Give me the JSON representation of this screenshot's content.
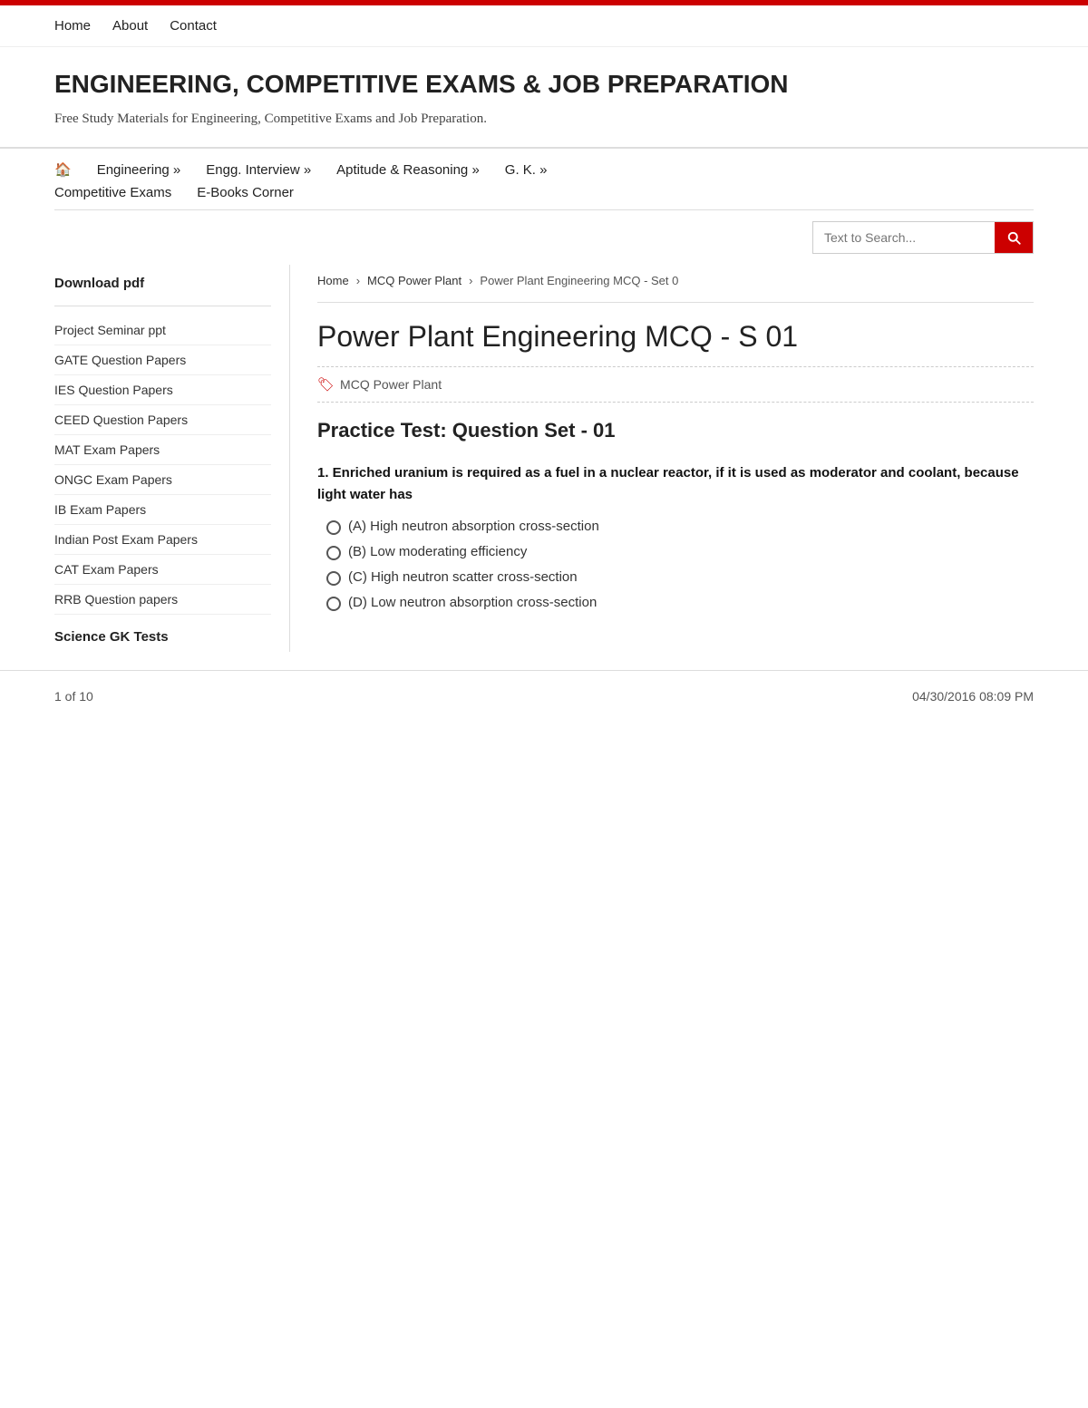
{
  "top_red_bar": {},
  "top_nav": {
    "items": [
      {
        "label": "Home",
        "id": "home"
      },
      {
        "label": "About",
        "id": "about"
      },
      {
        "label": "Contact",
        "id": "contact"
      }
    ]
  },
  "site_header": {
    "title": "ENGINEERING, COMPETITIVE EXAMS & JOB PREPARATION",
    "description": "Free Study Materials for Engineering, Competitive Exams and Job Preparation."
  },
  "main_nav": {
    "row1": [
      {
        "label": "🏠",
        "id": "home-icon",
        "is_icon": true
      },
      {
        "label": "Engineering »",
        "id": "engineering"
      },
      {
        "label": "Engg. Interview »",
        "id": "engg-interview"
      },
      {
        "label": "Aptitude & Reasoning »",
        "id": "aptitude"
      },
      {
        "label": "G. K. »",
        "id": "gk"
      }
    ],
    "row2": [
      {
        "label": "Competitive Exams",
        "id": "competitive-exams"
      },
      {
        "label": "E-Books Corner",
        "id": "ebooks"
      }
    ]
  },
  "search": {
    "placeholder": "Text to Search...",
    "button_label": "Search"
  },
  "sidebar": {
    "download_label": "Download pdf",
    "items": [
      {
        "label": "Project Seminar ppt"
      },
      {
        "label": "GATE Question Papers"
      },
      {
        "label": "IES Question Papers"
      },
      {
        "label": "CEED Question Papers"
      },
      {
        "label": "MAT Exam Papers"
      },
      {
        "label": "ONGC Exam Papers"
      },
      {
        "label": "IB Exam Papers"
      },
      {
        "label": "Indian Post Exam Papers"
      },
      {
        "label": "CAT Exam Papers"
      },
      {
        "label": "RRB Question papers"
      }
    ],
    "section_title": "Science GK Tests"
  },
  "breadcrumb": {
    "items": [
      {
        "label": "Home"
      },
      {
        "label": "MCQ Power Plant"
      },
      {
        "label": "Power Plant Engineering MCQ - Set 0"
      }
    ]
  },
  "article": {
    "title": "Power Plant Engineering MCQ - S 01",
    "tag": "MCQ Power Plant",
    "practice_title": "Practice Test: Question Set - 01",
    "question1": {
      "text": "1. Enriched uranium is required as a fuel in a nuclear reactor, if it is used as moderator and coolant, because light water has",
      "options": [
        {
          "id": "A",
          "label": "(A) High neutron absorption cross-section"
        },
        {
          "id": "B",
          "label": "(B) Low moderating efficiency"
        },
        {
          "id": "C",
          "label": "(C) High neutron scatter cross-section"
        },
        {
          "id": "D",
          "label": "(D) Low neutron absorption cross-section"
        }
      ]
    }
  },
  "footer": {
    "page_info": "1 of 10",
    "timestamp": "04/30/2016 08:09 PM"
  }
}
